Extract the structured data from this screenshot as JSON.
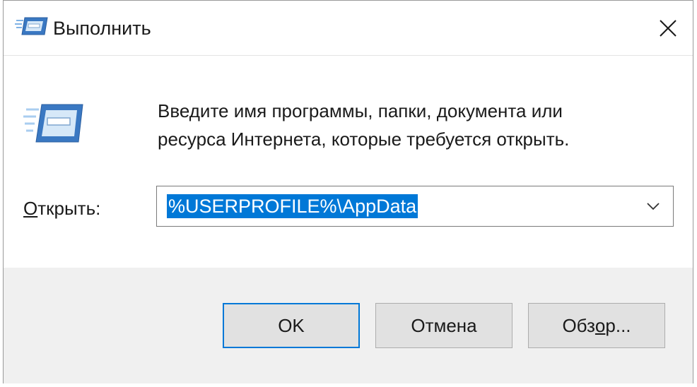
{
  "window": {
    "title": "Выполнить",
    "title_icon": "run-dialog-icon",
    "close_icon": "close-icon"
  },
  "content": {
    "description_line1": "Введите имя программы, папки, документа или",
    "description_line2": "ресурса Интернета, которые требуется открыть.",
    "open_label_underlined": "О",
    "open_label_rest": "ткрыть:",
    "combo_value": "%USERPROFILE%\\AppData",
    "combo_arrow_icon": "chevron-down-icon",
    "selection_color": "#0078d7"
  },
  "buttons": {
    "ok_label": "OK",
    "cancel_label": "Отмена",
    "browse_label_before": "Обз",
    "browse_label_underlined": "о",
    "browse_label_after": "р..."
  }
}
